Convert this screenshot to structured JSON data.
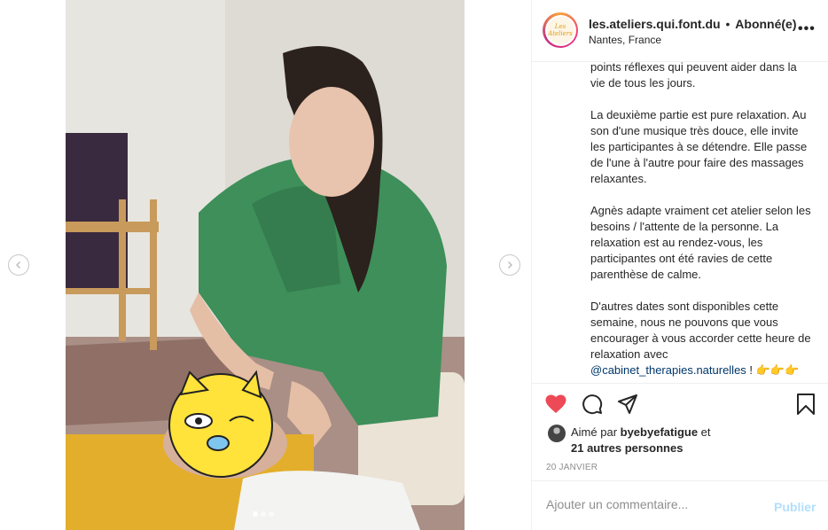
{
  "header": {
    "username": "les.ateliers.qui.font.du",
    "separator": "•",
    "follow_status": "Abonné(e)",
    "location": "Nantes, France",
    "more": "•••",
    "avatar_text": "Les Ateliers"
  },
  "caption": {
    "paragraphs": [
      "points réflexes qui peuvent aider dans la vie de tous les jours.",
      "La deuxième partie est pure relaxation. Au son d'une musique très douce, elle invite les participantes à se détendre. Elle passe de l'une à l'autre pour faire des massages relaxantes.",
      "Agnès adapte vraiment cet atelier selon les besoins / l'attente de la personne. La relaxation est au rendez-vous, les participantes ont été ravies de cette parenthèse de calme.",
      "D'autres dates sont disponibles cette semaine, nous ne pouvons que vous encourager à vous accorder cette heure de relaxation avec"
    ],
    "mention": "@cabinet_therapies.naturelles",
    "trailing": " ! 👉👉👉"
  },
  "actions": {
    "like_icon": "heart-icon",
    "comment_icon": "comment-icon",
    "share_icon": "share-icon",
    "save_icon": "bookmark-icon",
    "like_color": "#ed4956"
  },
  "likes": {
    "prefix": "Aimé par ",
    "user": "byebyefatigue",
    "middle": " et",
    "others": "21 autres personnes"
  },
  "date": "20 JANVIER",
  "comment": {
    "placeholder": "Ajouter un commentaire...",
    "publish_label": "Publier"
  },
  "carousel": {
    "slides": 3,
    "active_slide": 1
  }
}
